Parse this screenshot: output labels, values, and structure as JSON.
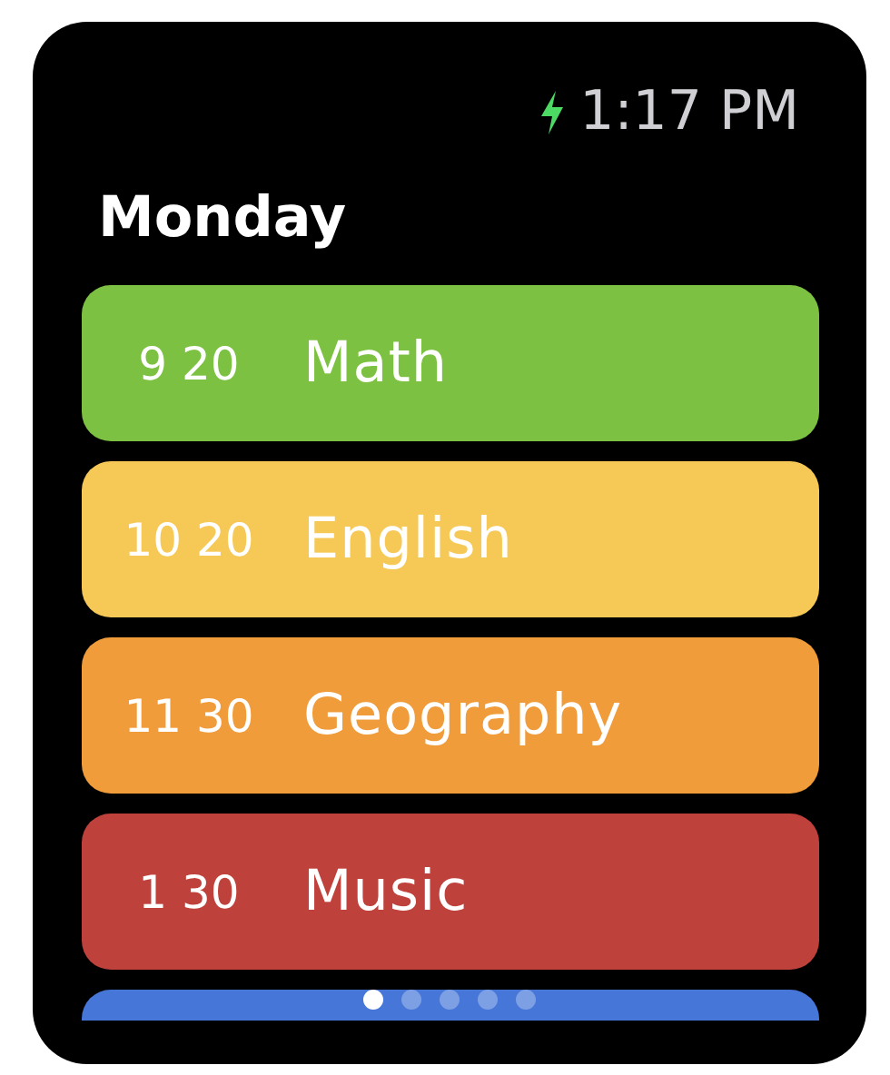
{
  "status_bar": {
    "charging": true,
    "time": "1:17 PM"
  },
  "title": "Monday",
  "lessons": [
    {
      "time": "9 20",
      "subject": "Math",
      "color": "#7dc142"
    },
    {
      "time": "10 20",
      "subject": "English",
      "color": "#f6c957"
    },
    {
      "time": "11 30",
      "subject": "Geography",
      "color": "#f09c3a"
    },
    {
      "time": "1 30",
      "subject": "Music",
      "color": "#bf413b"
    },
    {
      "color": "#4676d8"
    }
  ],
  "page_dots": [
    {
      "selected": true
    },
    {
      "selected": false
    },
    {
      "selected": false
    },
    {
      "selected": false
    },
    {
      "selected": false
    }
  ]
}
